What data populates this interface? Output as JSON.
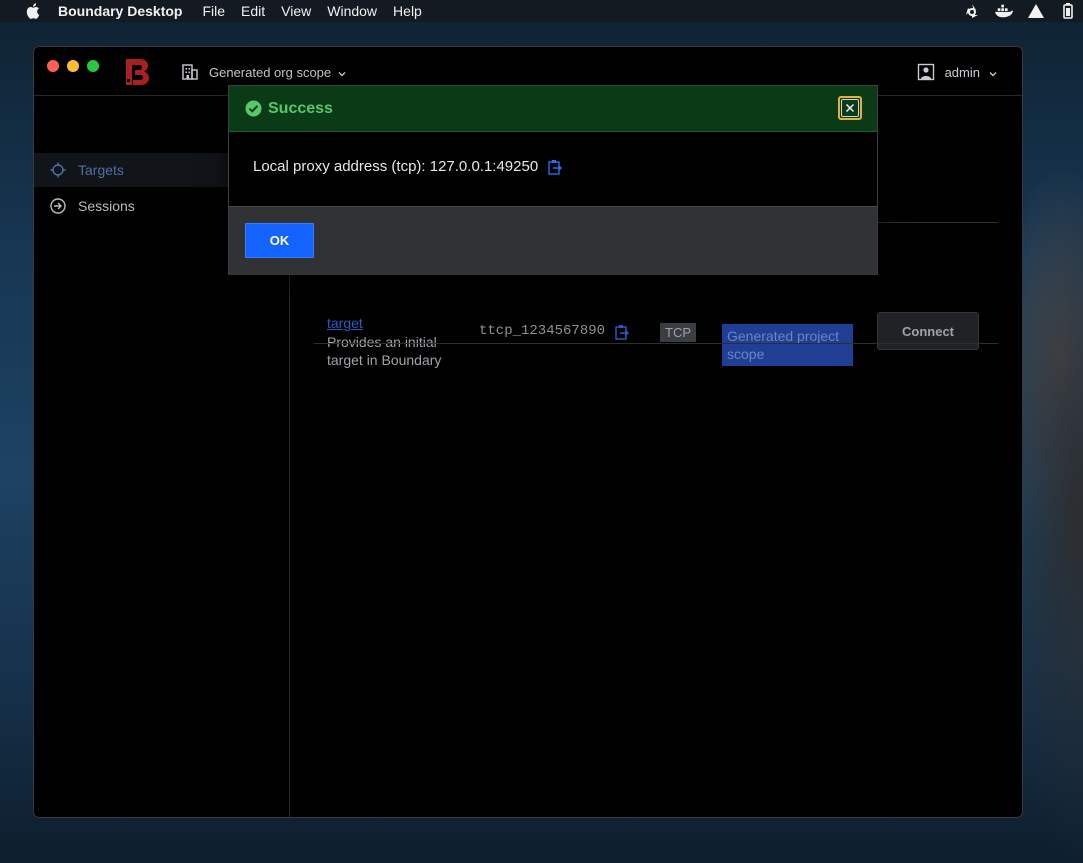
{
  "menubar": {
    "apple_icon": "apple-icon",
    "app_name": "Boundary Desktop",
    "items": [
      "File",
      "Edit",
      "View",
      "Window",
      "Help"
    ],
    "tray_icons": [
      "recycle-icon",
      "docker-icon",
      "drive-icon",
      "battery-icon"
    ]
  },
  "window": {
    "scope_label": "Generated org scope",
    "user_label": "admin"
  },
  "sidebar": {
    "items": [
      {
        "label": "Targets",
        "icon": "target-icon",
        "active": true
      },
      {
        "label": "Sessions",
        "icon": "session-icon",
        "active": false
      }
    ]
  },
  "target_row": {
    "name_link": "target",
    "description": "Provides an initial target in Boundary",
    "id": "ttcp_1234567890",
    "type": "TCP",
    "scope": "Generated project scope",
    "connect_label": "Connect"
  },
  "modal": {
    "title": "Success",
    "message": "Local proxy address (tcp): 127.0.0.1:49250",
    "ok_label": "OK"
  },
  "colors": {
    "accent_blue": "#1563ff",
    "success_green": "#56c86a",
    "focus_ring": "#e2b13c"
  }
}
